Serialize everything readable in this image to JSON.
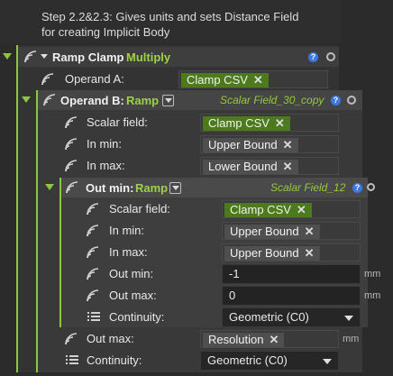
{
  "note": {
    "line1": "Step 2.2&2.3: Gives units and sets Distance Field",
    "line2": "for creating Implicit Body"
  },
  "ramp_clamp": {
    "title": "Ramp Clamp",
    "mode": "Multiply",
    "operand_a": {
      "label": "Operand A:",
      "value": "Clamp CSV"
    }
  },
  "operand_b": {
    "title": "Operand B:",
    "mode": "Ramp",
    "name": "Scalar Field_30_copy",
    "scalar_field": {
      "label": "Scalar field:",
      "value": "Clamp CSV"
    },
    "in_min": {
      "label": "In min:",
      "value": "Upper Bound"
    },
    "in_max": {
      "label": "In max:",
      "value": "Lower Bound"
    },
    "out_max": {
      "label": "Out max:",
      "value": "Resolution",
      "unit": "mm"
    },
    "continuity": {
      "label": "Continuity:",
      "value": "Geometric (C0)"
    }
  },
  "out_min": {
    "title": "Out min:",
    "mode": "Ramp",
    "name": "Scalar Field_12",
    "scalar_field": {
      "label": "Scalar field:",
      "value": "Clamp CSV"
    },
    "in_min": {
      "label": "In min:",
      "value": "Upper Bound"
    },
    "in_max": {
      "label": "In max:",
      "value": "Upper Bound"
    },
    "out_min": {
      "label": "Out min:",
      "value": "-1",
      "unit": "mm"
    },
    "out_max": {
      "label": "Out max:",
      "value": "0",
      "unit": "mm"
    },
    "continuity": {
      "label": "Continuity:",
      "value": "Geometric (C0)"
    }
  },
  "icons": {
    "help": "?",
    "remove": "✕"
  },
  "colors": {
    "accent_green": "#8dc63f",
    "help_blue": "#3d77e0"
  }
}
